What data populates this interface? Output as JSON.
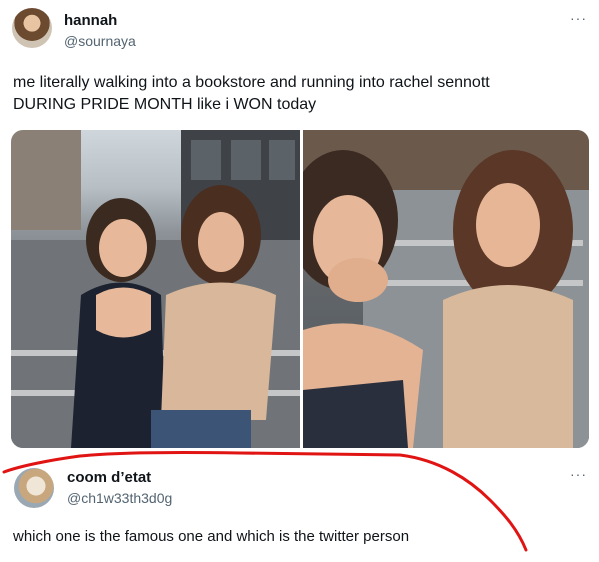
{
  "tweet": {
    "author_name": "hannah",
    "author_handle": "@sournaya",
    "more_label": "···",
    "text_line1": "me literally walking into a bookstore and running into rachel sennott",
    "text_line2": "DURING PRIDE MONTH like i WON today",
    "avatar_icon": "profile-photo",
    "photos": [
      {
        "description": "two women posing on a city street"
      },
      {
        "description": "close-up of the two women smiling"
      }
    ]
  },
  "reply": {
    "author_name": "coom d’etat",
    "author_handle": "@ch1w33th3d0g",
    "more_label": "···",
    "text": "which one is the famous one and which is the twitter person",
    "avatar_icon": "dog-profile-photo"
  },
  "annotation": {
    "color": "#e11414"
  }
}
